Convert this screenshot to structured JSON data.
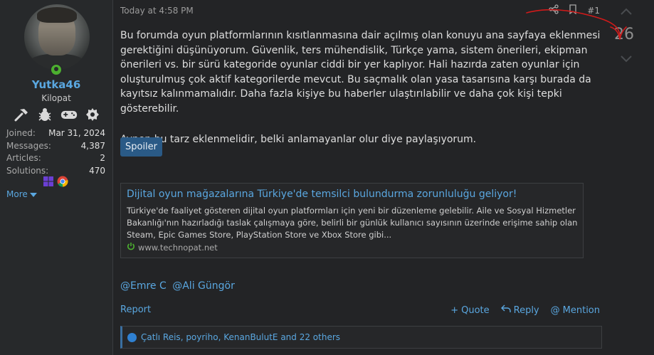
{
  "user": {
    "username": "Yutka46",
    "title": "Kilopat",
    "badges": [
      "hammer-icon",
      "bug-icon",
      "gamepad-icon",
      "gear-badge-icon"
    ],
    "stats": [
      {
        "label": "Joined:",
        "value": "Mar 31, 2024"
      },
      {
        "label": "Messages:",
        "value": "4,387"
      },
      {
        "label": "Articles:",
        "value": "2"
      },
      {
        "label": "Solutions:",
        "value": "470"
      }
    ],
    "app_icons": [
      "windows-icon",
      "chrome-icon"
    ],
    "more_label": "More"
  },
  "post": {
    "time": "Today at 4:58 PM",
    "number": "#1",
    "vote_count": "26",
    "paragraph1": "Bu forumda oyun platformlarının kısıtlanmasına dair açılmış olan konuyu ana sayfaya eklenmesi gerektiğini düşünüyorum. Güvenlik, ters mühendislik, Türkçe yama, sistem önerileri, ekipman önerileri vs. bir sürü kategoride oyunlar ciddi bir yer kaplıyor. Hali hazırda zaten oyunlar için oluşturulmuş çok aktif kategorilerde mevcut. Bu saçmalık olan yasa tasarısına karşı burada da kayıtsız kalınmamalıdır. Daha fazla kişiye bu haberler ulaştırılabilir ve daha çok kişi tepki gösterebilir.",
    "paragraph2": "Aynen bu tarz eklenmelidir, belki anlamayanlar olur diye paylaşıyorum.",
    "spoiler_label": "Spoiler",
    "unfurl": {
      "title": "Dijital oyun mağazalarına Türkiye'de temsilci bulundurma zorunluluğu geliyor!",
      "description": "Türkiye'de faaliyet gösteren dijital oyun platformları için yeni bir düzenleme gelebilir. Aile ve Sosyal Hizmetler Bakanlığı'nın hazırladığı taslak çalışmaya göre, belirli bir günlük kullanıcı sayısının üzerinde erişime sahip olan Steam, Epic Games Store, PlayStation Store ve Xbox Store gibi...",
      "domain": "www.technopat.net"
    },
    "mentions": [
      "@Emre C",
      "@Ali Güngör"
    ],
    "report_label": "Report",
    "quote_label": "Quote",
    "reply_label": "Reply",
    "mention_label": "Mention",
    "reactions_text": "Çatlı Reis, poyriho, KenanBulutE and 22 others"
  },
  "colors": {
    "accent": "#5aa7e0",
    "background": "#232426",
    "online": "#4caf2f",
    "spoiler_button": "#2a5a86",
    "annotation": "#d11a1a"
  }
}
